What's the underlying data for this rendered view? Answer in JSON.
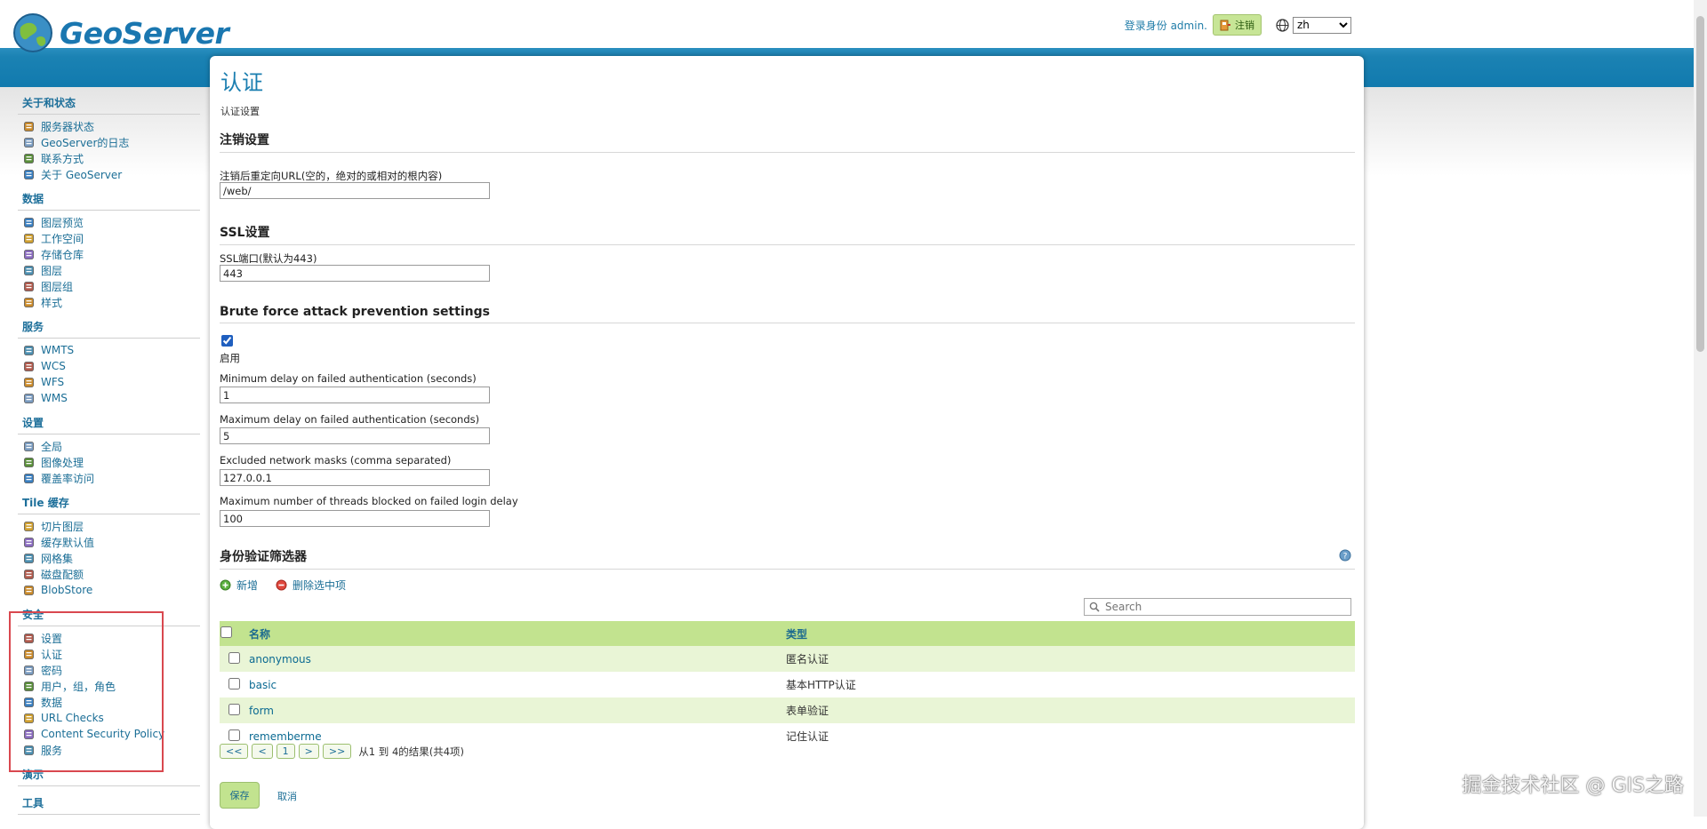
{
  "header": {
    "logo_text": "GeoServer",
    "logged_in_text": "登录身份 admin.",
    "logout_label": "注销",
    "language": "zh"
  },
  "sidebar": {
    "groups": [
      {
        "title": "关于和状态",
        "items": [
          "服务器状态",
          "GeoServer的日志",
          "联系方式",
          "关于 GeoServer"
        ]
      },
      {
        "title": "数据",
        "items": [
          "图层预览",
          "工作空间",
          "存储仓库",
          "图层",
          "图层组",
          "样式"
        ]
      },
      {
        "title": "服务",
        "items": [
          "WMTS",
          "WCS",
          "WFS",
          "WMS"
        ]
      },
      {
        "title": "设置",
        "items": [
          "全局",
          "图像处理",
          "覆盖率访问"
        ]
      },
      {
        "title": "Tile 缓存",
        "items": [
          "切片图层",
          "缓存默认值",
          "网格集",
          "磁盘配额",
          "BlobStore"
        ]
      },
      {
        "title": "安全",
        "items": [
          "设置",
          "认证",
          "密码",
          "用户，组，角色",
          "数据",
          "URL Checks",
          "Content Security Policy",
          "服务"
        ]
      },
      {
        "title": "演示",
        "items": []
      },
      {
        "title": "工具",
        "items": []
      }
    ]
  },
  "main": {
    "title": "认证",
    "subtitle": "认证设置",
    "logout_section": {
      "title": "注销设置",
      "redirect_label": "注销后重定向URL(空的，绝对的或相对的根内容)",
      "redirect_value": "/web/"
    },
    "ssl_section": {
      "title": "SSL设置",
      "port_label": "SSL端口(默认为443)",
      "port_value": "443"
    },
    "bruteforce_section": {
      "title": "Brute force attack prevention settings",
      "enabled_label": "启用",
      "min_delay_label": "Minimum delay on failed authentication (seconds)",
      "min_delay_value": "1",
      "max_delay_label": "Maximum delay on failed authentication (seconds)",
      "max_delay_value": "5",
      "masks_label": "Excluded network masks (comma separated)",
      "masks_value": "127.0.0.1",
      "threads_label": "Maximum number of threads blocked on failed login delay",
      "threads_value": "100"
    },
    "filters_section": {
      "title": "身份验证筛选器",
      "add_label": "新增",
      "remove_label": "删除选中项",
      "search_placeholder": "Search",
      "col_name": "名称",
      "col_type": "类型",
      "rows": [
        {
          "name": "anonymous",
          "type": "匿名认证"
        },
        {
          "name": "basic",
          "type": "基本HTTP认证"
        },
        {
          "name": "form",
          "type": "表单验证"
        },
        {
          "name": "rememberme",
          "type": "记住认证"
        }
      ],
      "pager": {
        "first": "<<",
        "prev": "<",
        "page": "1",
        "next": ">",
        "last": ">>",
        "summary": "从1 到 4的结果(共4项)"
      }
    },
    "save_label": "保存",
    "cancel_label": "取消"
  },
  "watermark": "掘金技术社区 @ GIS之路",
  "colors": {
    "accent": "#1a7eb0",
    "table_header": "#c2e38f",
    "highlight_border": "#d9484f"
  }
}
